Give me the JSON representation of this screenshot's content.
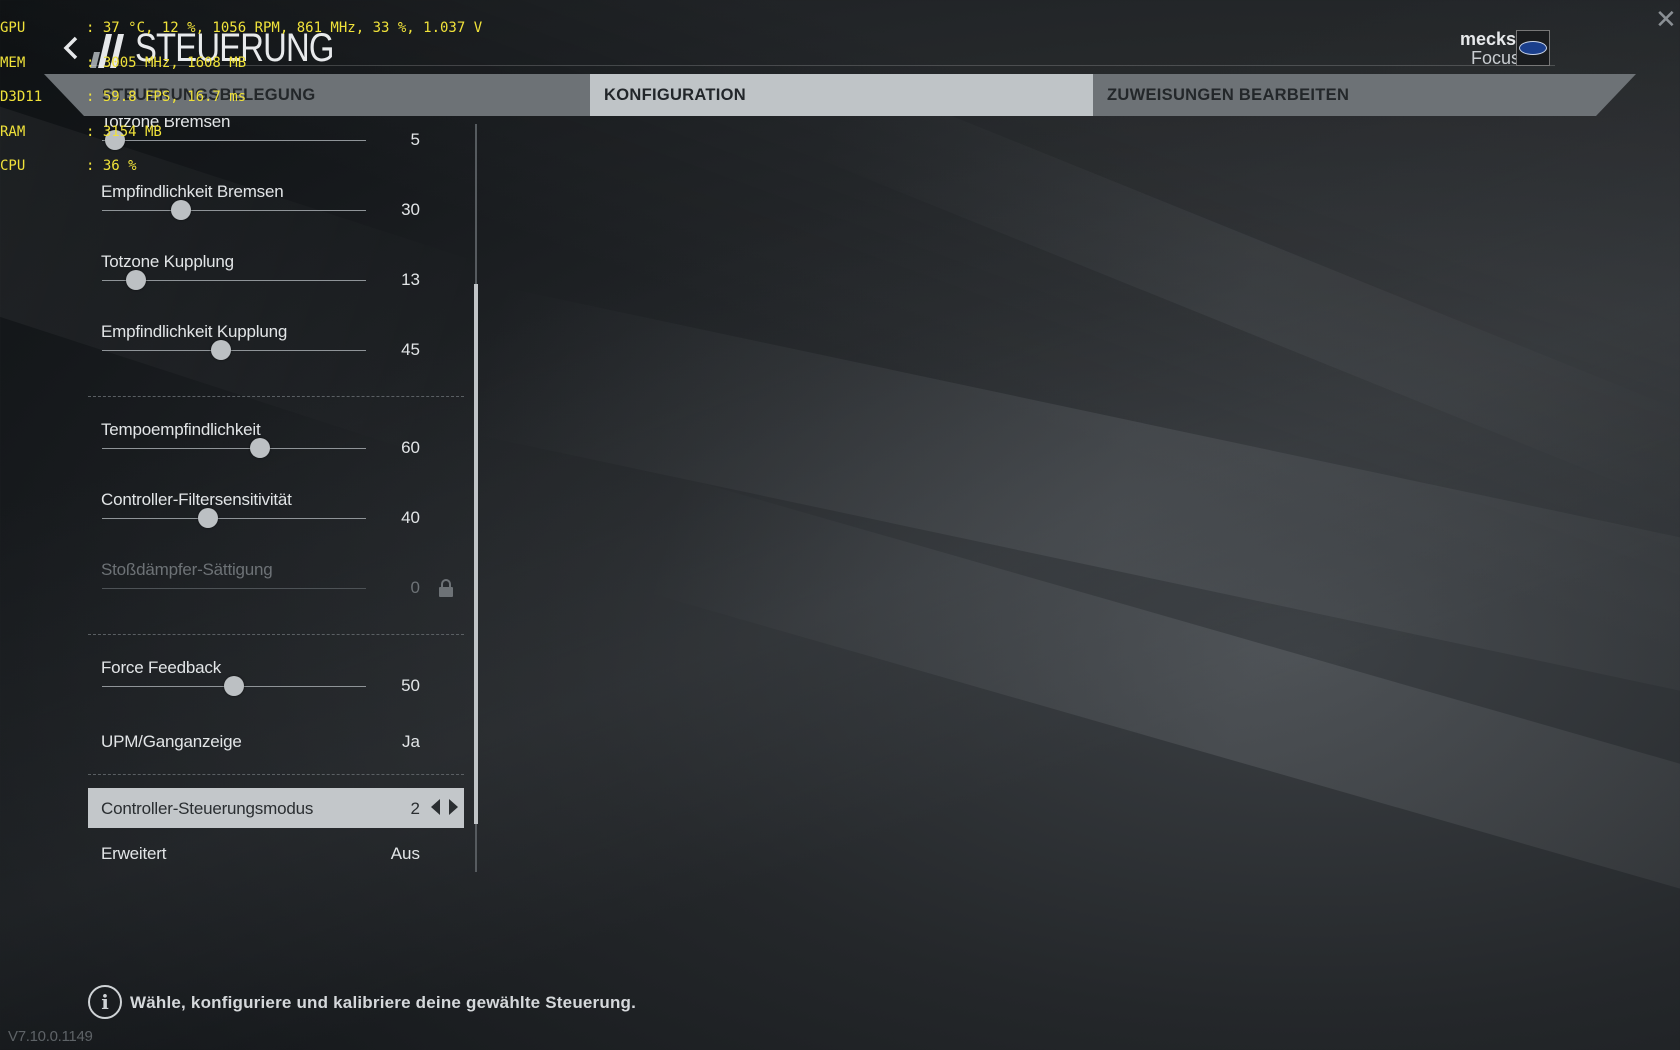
{
  "osd": [
    {
      "key": "GPU",
      "value": ": 37 °C, 12 %, 1056 RPM, 861 MHz, 33 %, 1.037 V"
    },
    {
      "key": "MEM",
      "value": ": 3005 MHz, 1608 MB"
    },
    {
      "key": "D3D11",
      "value": ": 59.8 FPS, 16.7 ms"
    },
    {
      "key": "RAM",
      "value": ": 3154 MB"
    },
    {
      "key": "CPU",
      "value": ": 36 %"
    }
  ],
  "header": {
    "title": "STEUERUNG",
    "user_name": "meckswell",
    "car_name": "Focus RS",
    "close_symbol": "✕"
  },
  "tabs": [
    {
      "label": "STEUERUNGSBELEGUNG",
      "active": false
    },
    {
      "label": "KONFIGURATION",
      "active": true
    },
    {
      "label": "ZUWEISUNGEN BEARBEITEN",
      "active": false
    }
  ],
  "settings": {
    "totzone_bremsen": {
      "label": "Totzone Bremsen",
      "value": "5",
      "level": 0.05
    },
    "empfindlichkeit_bremsen": {
      "label": "Empfindlichkeit Bremsen",
      "value": "30",
      "level": 0.3
    },
    "totzone_kupplung": {
      "label": "Totzone Kupplung",
      "value": "13",
      "level": 0.13
    },
    "empfindlichkeit_kupplung": {
      "label": "Empfindlichkeit Kupplung",
      "value": "45",
      "level": 0.45
    },
    "tempoempfindlichkeit": {
      "label": "Tempoempfindlichkeit",
      "value": "60",
      "level": 0.6
    },
    "filtersensitivitaet": {
      "label": "Controller-Filtersensitivität",
      "value": "40",
      "level": 0.4
    },
    "stossdaempfer": {
      "label": "Stoßdämpfer-Sättigung",
      "value": "0",
      "locked": true
    },
    "force_feedback": {
      "label": "Force Feedback",
      "value": "50",
      "level": 0.5
    },
    "upm_ganganzeige": {
      "label": "UPM/Ganganzeige",
      "value": "Ja"
    },
    "steuerungsmodus": {
      "label": "Controller-Steuerungsmodus",
      "value": "2"
    },
    "erweitert": {
      "label": "Erweitert",
      "value": "Aus"
    }
  },
  "footer": {
    "info_symbol": "i",
    "hint": "Wähle, konfiguriere und kalibriere deine gewählte Steuerung.",
    "version": "V7.10.0.1149"
  },
  "colors": {
    "osd": "#f0e23a",
    "tab_active": "#bfc4c7",
    "tab_inactive": "#6d7276",
    "ford_blue": "#1b3f8c"
  },
  "icons": [
    "back-arrow-icon",
    "close-icon",
    "ford-logo-icon",
    "lock-icon",
    "info-icon",
    "chevron-left-icon",
    "chevron-right-icon"
  ]
}
